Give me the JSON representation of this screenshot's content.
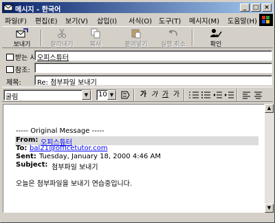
{
  "window": {
    "title": "메시지 - 한국어",
    "controls": [
      "_",
      "□",
      "×"
    ]
  },
  "menu": [
    "파일(F)",
    "편집(E)",
    "보기(V)",
    "삽입(I)",
    "서식(O)",
    "도구(T)",
    "메시지(M)",
    "도움말(H)"
  ],
  "toolbar": {
    "send": "보내기",
    "cut": "잘라내기",
    "copy": "복사",
    "paste": "붙여넣기",
    "undo": "실행 취소",
    "check": "확인"
  },
  "headers": {
    "to_label": "받는 사람:",
    "to_value": "오피스튜터",
    "cc_label": "참조:",
    "cc_value": "",
    "subject_label": "제목:",
    "subject_value": "Re: 첨부파일 보내기"
  },
  "format": {
    "font": "굴림",
    "size": "10",
    "buttons": [
      "가",
      "가",
      "가",
      "가"
    ]
  },
  "message": {
    "divider": "----- Original Message -----",
    "from_label": "From:",
    "from_value": "오피스튜터",
    "to_label": "To:",
    "to_value": "bal21@officetutor.com",
    "sent_label": "Sent:",
    "sent_value": "Tuesday, January 18, 2000 4:46 AM",
    "subject_label": "Subject:",
    "subject_value": "첨부파일 보내기",
    "body": "오늘은 첨부파일을 보내기 연습중입니다."
  }
}
